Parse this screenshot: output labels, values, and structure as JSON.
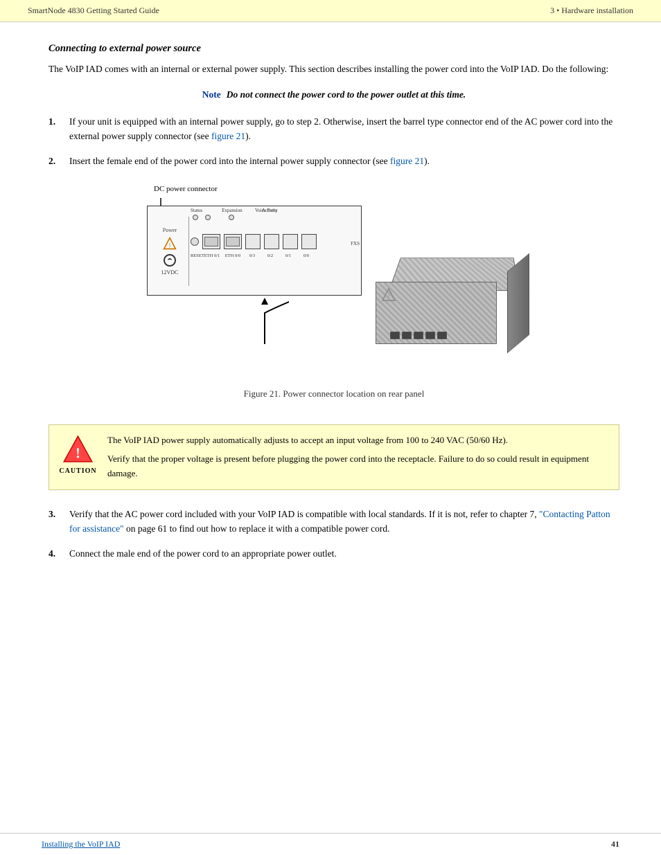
{
  "header": {
    "left_text": "SmartNode 4830 Getting Started Guide",
    "chapter_num": "3",
    "bullet": "•",
    "chapter_title": "Hardware installation"
  },
  "section": {
    "heading": "Connecting to external power source",
    "intro": "The VoIP IAD comes with an internal or external power supply. This section describes installing the power cord into the VoIP IAD. Do the following:",
    "note_label": "Note",
    "note_text": "Do not connect the power cord to the power outlet at this time.",
    "steps": [
      {
        "num": "1.",
        "text_before": "If your unit is equipped with an internal power supply, go to step 2. Otherwise, insert the barrel type connector end of the AC power cord into the external power supply connector (see ",
        "link_text": "figure 21",
        "text_after": ")."
      },
      {
        "num": "2.",
        "text_before": "Insert the female end of the power cord into the internal power supply connector (see ",
        "link_text": "figure 21",
        "text_after": ")."
      }
    ]
  },
  "figure": {
    "diagram_label": "DC power connector",
    "panel_labels": {
      "status": "Status",
      "expansion": "Expansion",
      "activity": "Activity",
      "voice_ports": "Voice Ports",
      "reset": "RESET",
      "eth01": "ETH 0/1",
      "eth00": "ETH 0/0",
      "p03": "0/3",
      "p02": "0/2",
      "p01": "0/1",
      "p00": "0/0",
      "fxs": "FXS",
      "power": "Power",
      "vdc": "12VDC"
    },
    "caption": "Figure 21. Power connector location on rear panel"
  },
  "caution": {
    "label": "CAUTION",
    "paragraph1": "The VoIP IAD power supply automatically adjusts to accept an input voltage from 100 to 240 VAC (50/60 Hz).",
    "paragraph2": "Verify that the proper voltage is present before plugging the power cord into the receptacle. Failure to do so could result in equipment damage."
  },
  "steps_after": [
    {
      "num": "3.",
      "text_before": "Verify that the AC power cord included with your VoIP IAD is compatible with local standards. If it is not, refer to chapter 7, ",
      "link_text": "\"Contacting Patton for assistance\"",
      "text_after": " on page 61 to find out how to replace it with a compatible power cord."
    },
    {
      "num": "4.",
      "text": "Connect the male end of the power cord to an appropriate power outlet."
    }
  ],
  "footer": {
    "left": "Installing the VoIP IAD",
    "right": "41"
  }
}
